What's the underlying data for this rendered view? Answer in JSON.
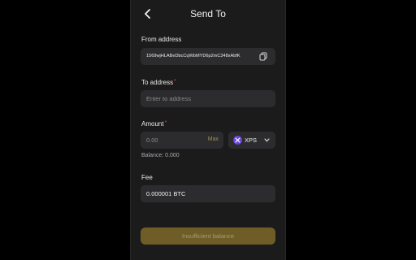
{
  "header": {
    "title": "Send To",
    "back_icon": "chevron-left-icon"
  },
  "from": {
    "label": "From address",
    "value": "1569wjHLABeDbcCqWbMYD6p2mC348xAbfK",
    "copy_icon": "copy-icon"
  },
  "to": {
    "label": "To address",
    "required_mark": "*",
    "placeholder": "Enter to address"
  },
  "amount": {
    "label": "Amount",
    "required_mark": "*",
    "placeholder": "0.00",
    "max_label": "Max",
    "balance_text": "Balance: 0.000"
  },
  "token": {
    "symbol": "XPS",
    "icon": "xps-token-icon",
    "icon_color": "#6b46d9",
    "dropdown_icon": "chevron-down-icon"
  },
  "fee": {
    "label": "Fee",
    "value": "0.000001 BTC"
  },
  "submit": {
    "label": "Insufficient balance",
    "color": "#6e5d27"
  }
}
